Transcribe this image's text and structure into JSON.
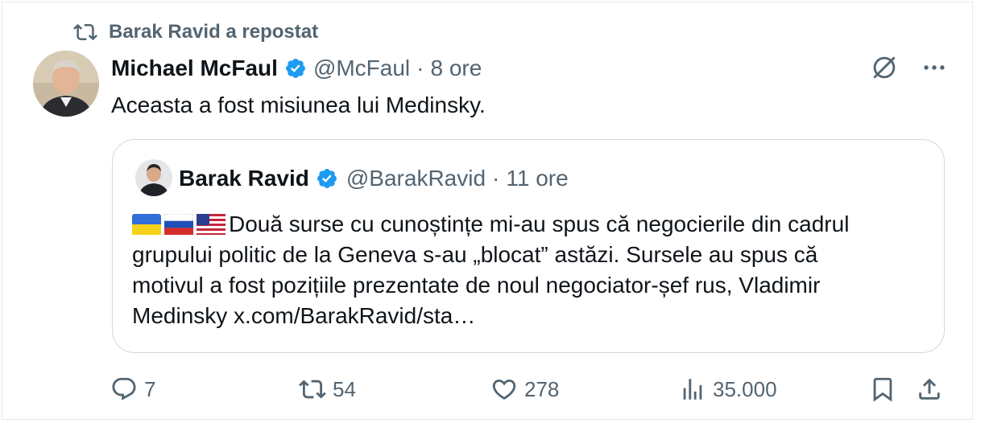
{
  "repost": {
    "label": "Barak Ravid a repostat",
    "icon": "repost-icon"
  },
  "tweet": {
    "author_name": "Michael McFaul",
    "handle": "@McFaul",
    "separator": "·",
    "time": "8 ore",
    "text": "Aceasta a fost misiunea lui Medinsky."
  },
  "quote": {
    "author_name": "Barak Ravid",
    "handle": "@BarakRavid",
    "separator": "·",
    "time": "11 ore",
    "flags": [
      "ukraine-flag",
      "russia-flag",
      "usa-flag"
    ],
    "text_line1": "Două surse cu cunoștințe mi-au spus că negocierile din cadrul",
    "text_line2": "grupului politic de la Geneva s-au „blocat” astăzi. Sursele au spus că",
    "text_line3": "motivul a fost pozițiile prezentate de noul negociator-șef rus, Vladimir",
    "text_line4": "Medinsky x.com/BarakRavid/sta…"
  },
  "actions": {
    "replies": "7",
    "reposts": "54",
    "likes": "278",
    "views": "35.000"
  },
  "colors": {
    "muted": "#536471",
    "verified": "#1d9bf0",
    "text": "#0f1419",
    "border": "#cfd9de"
  }
}
